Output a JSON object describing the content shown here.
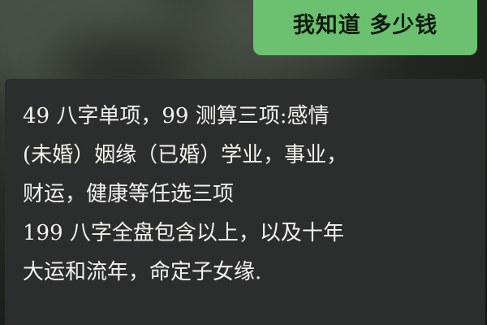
{
  "chat": {
    "sent_message": "我知道 多少钱",
    "received_message": {
      "lines": [
        "49 八字单项，99 测算三项:感情",
        "(未婚）姻缘（已婚）学业，事业，",
        "财运，健康等任选三项",
        "199 八字全盘包含以上，以及十年",
        "大运和流年，命定子女缘."
      ]
    }
  }
}
